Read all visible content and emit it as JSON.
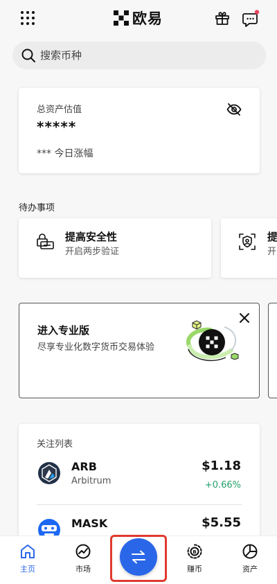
{
  "header": {
    "brand": "欧易",
    "menu_icon": "grid-menu-icon",
    "gift_icon": "gift-icon",
    "chat_icon": "chat-bubble-icon",
    "notification_dot_color": "#e8455b"
  },
  "search": {
    "placeholder": "搜索币种"
  },
  "asset": {
    "title": "总资产估值",
    "value": "*****",
    "change": "*** 今日涨幅",
    "visibility_icon": "eye-off-icon"
  },
  "todo": {
    "section_title": "待办事项",
    "items": [
      {
        "title": "提高安全性",
        "desc": "开启两步验证",
        "icon": "security-key-icon"
      },
      {
        "title": "提",
        "desc": "开",
        "icon": "identity-verify-icon"
      }
    ]
  },
  "promo": {
    "title": "进入专业版",
    "desc": "尽享专业化数字货币交易体验",
    "close_icon": "close-icon",
    "art_icon": "okx-pro-illustration"
  },
  "watchlist": {
    "title": "关注列表",
    "coins": [
      {
        "symbol": "ARB",
        "name": "Arbitrum",
        "price": "$1.18",
        "change": "+0.66%"
      },
      {
        "symbol": "MASK",
        "name": "",
        "price": "$5.55",
        "change": ""
      }
    ]
  },
  "nav": {
    "items": [
      {
        "label": "主页",
        "icon": "home-icon",
        "active": true
      },
      {
        "label": "市场",
        "icon": "market-icon"
      },
      {
        "label": "",
        "icon": "trade-swap-icon"
      },
      {
        "label": "赚币",
        "icon": "earn-icon"
      },
      {
        "label": "资产",
        "icon": "assets-pie-icon"
      }
    ]
  },
  "colors": {
    "accent": "#2a67e8",
    "positive": "#22a06b",
    "highlight_box": "#e0392e"
  }
}
